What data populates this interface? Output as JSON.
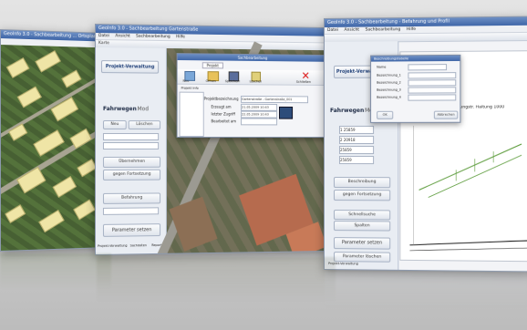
{
  "window_left": {
    "title": "GeoInfo 3.0 - Sachbearbeitung ... Ortsplan"
  },
  "window_mid": {
    "title": "GeoInfo 3.0 - Sachbearbeitung Gartenstraße",
    "menu": [
      "Datei",
      "Ansicht",
      "Sachbearbeitung",
      "Hilfe"
    ],
    "toolbar_text": "Karte",
    "project_button": "Projekt-Verwaltung",
    "tab_active": "Fahrwegen",
    "tab_other": "Mod",
    "panel_items": [
      "Neu",
      "Löschen",
      "Übernehmen",
      "gegen Fortsetzung",
      "Befahrung",
      "Parameter setzen"
    ],
    "status_tabs": [
      "Projekt-Verwaltung",
      "Sachdaten",
      "Report"
    ]
  },
  "dialog_mid": {
    "title": "Sachbearbeitung",
    "tab": "Projekt",
    "tools": [
      "Neu",
      "Öffnen",
      "Speichern",
      "Löschen",
      "Schließen"
    ],
    "list_header": "Projekt Info",
    "fields": [
      {
        "label": "Projektbezeichnung",
        "value": "Gartenstraße - Gartenstraße_001"
      },
      {
        "label": "Erzeugt am",
        "value": "21.05.2009 10:43"
      },
      {
        "label": "letzter Zugriff",
        "value": "22.05.2009 10:43"
      },
      {
        "label": "Bearbeitet am",
        "value": ""
      }
    ]
  },
  "window_right": {
    "title": "GeoInfo 3.0 - Sachbearbeitung - Befahrung und Profil",
    "menu": [
      "Datei",
      "Ansicht",
      "Sachbearbeitung",
      "Hilfe"
    ],
    "project_button": "Projekt-Verwaltung",
    "tab_active": "Fahrwegen",
    "tab_other": "Mod",
    "fields": [
      "1 25859",
      "2 20918",
      "25859",
      "25859"
    ],
    "panel_items": [
      "Beschreibung",
      "gegen Fortsetzung",
      "Schnellsuche",
      "Spalten",
      "Parameter setzen",
      "Parameter löschen"
    ],
    "profile_title": "Oberes Fl. Profil Nr. Ringstr. Haltung 1000",
    "status_text": "Projekt-Verwaltung"
  },
  "dialog_right": {
    "title": "Beschreibungstabelle",
    "rows": [
      "Name",
      "Bezeichnung_1",
      "Bezeichnung_2",
      "Bezeichnung_3",
      "Bezeichnung_4"
    ],
    "buttons": [
      "OK",
      "Abbrechen"
    ]
  },
  "colors": {
    "accent": "#3f66a8",
    "roof": "#efe5a6",
    "profile_line": "#5b9b3a"
  }
}
